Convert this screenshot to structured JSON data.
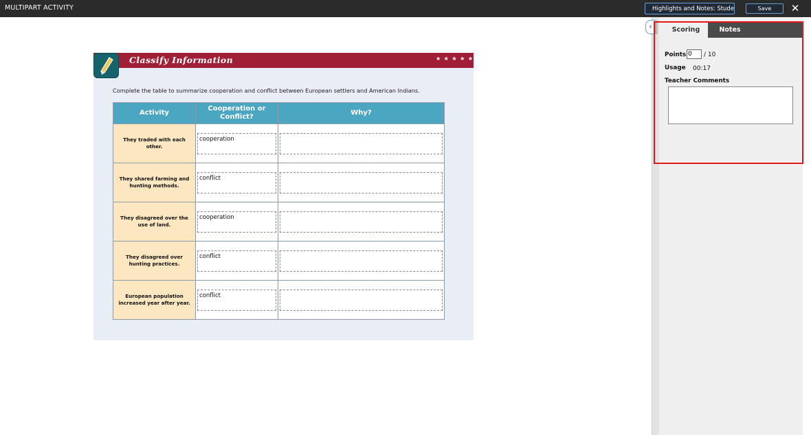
{
  "topbar": {
    "title": "MULTIPART ACTIVITY",
    "highlights_select": "Highlights and Notes: Student",
    "save_label": "Save",
    "close_glyph": "✕"
  },
  "activity": {
    "title": "Classify Information",
    "stars": "★ ★ ★ ★ ★",
    "instructions": "Complete the table to summarize cooperation and conflict between European settlers and American Indians.",
    "columns": [
      "Activity",
      "Cooperation or Conflict?",
      "Why?"
    ],
    "rows": [
      {
        "activity": "They traded with each other.",
        "answer": "cooperation",
        "why": ""
      },
      {
        "activity": "They shared farming and hunting methods.",
        "answer": "conflict",
        "why": ""
      },
      {
        "activity": "They disagreed over the use of land.",
        "answer": "cooperation",
        "why": ""
      },
      {
        "activity": "They disagreed over hunting practices.",
        "answer": "conflict",
        "why": ""
      },
      {
        "activity": "European population increased year after year.",
        "answer": "conflict",
        "why": ""
      }
    ]
  },
  "sidepanel": {
    "tabs": [
      "Scoring",
      "Notes"
    ],
    "active_tab": "Scoring",
    "points_label": "Points",
    "points_value": "0",
    "points_total": "/ 10",
    "usage_label": "Usage",
    "usage_value": "00:17",
    "comments_label": "Teacher Comments",
    "comments_value": ""
  },
  "icons": {
    "collapse": "chevron-left-icon",
    "close": "close-icon",
    "logo": "pencil-icon"
  },
  "colors": {
    "banner": "#a11f36",
    "table_header": "#4aa6c1",
    "activity_cell": "#fde7c0",
    "highlight": "#e01818"
  }
}
